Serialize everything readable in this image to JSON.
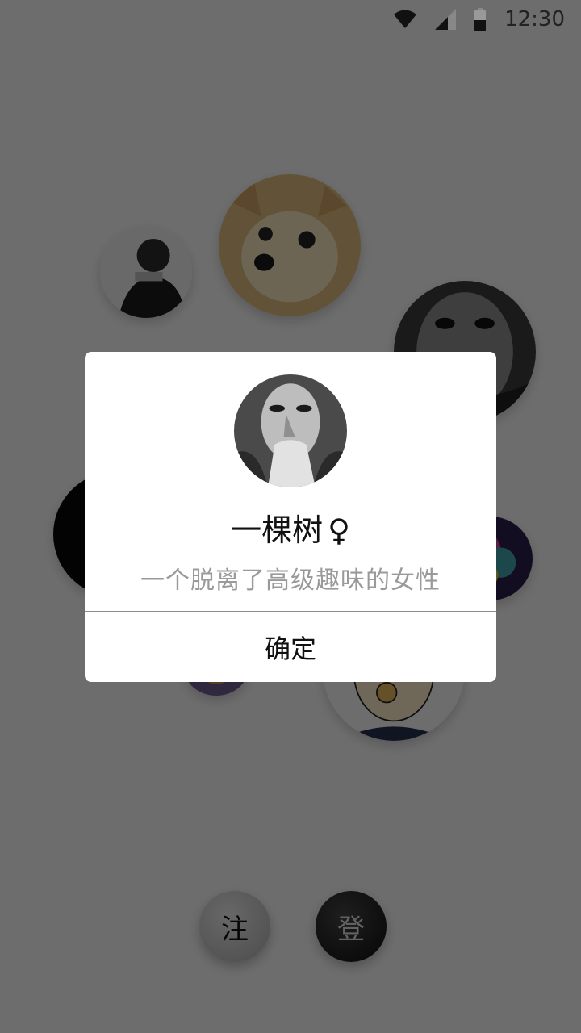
{
  "status_bar": {
    "time": "12:30",
    "icons": [
      "wifi-icon",
      "signal-icon",
      "battery-icon"
    ]
  },
  "dialog": {
    "name": "一棵树",
    "gender_symbol": "♀",
    "bio": "一个脱离了高级趣味的女性",
    "confirm_label": "确定"
  },
  "bottom_buttons": {
    "register_label": "注",
    "login_label": "登"
  },
  "colors": {
    "overlay": "#000000",
    "dialog_bg": "#ffffff",
    "bio_text": "#9a9a9a"
  }
}
